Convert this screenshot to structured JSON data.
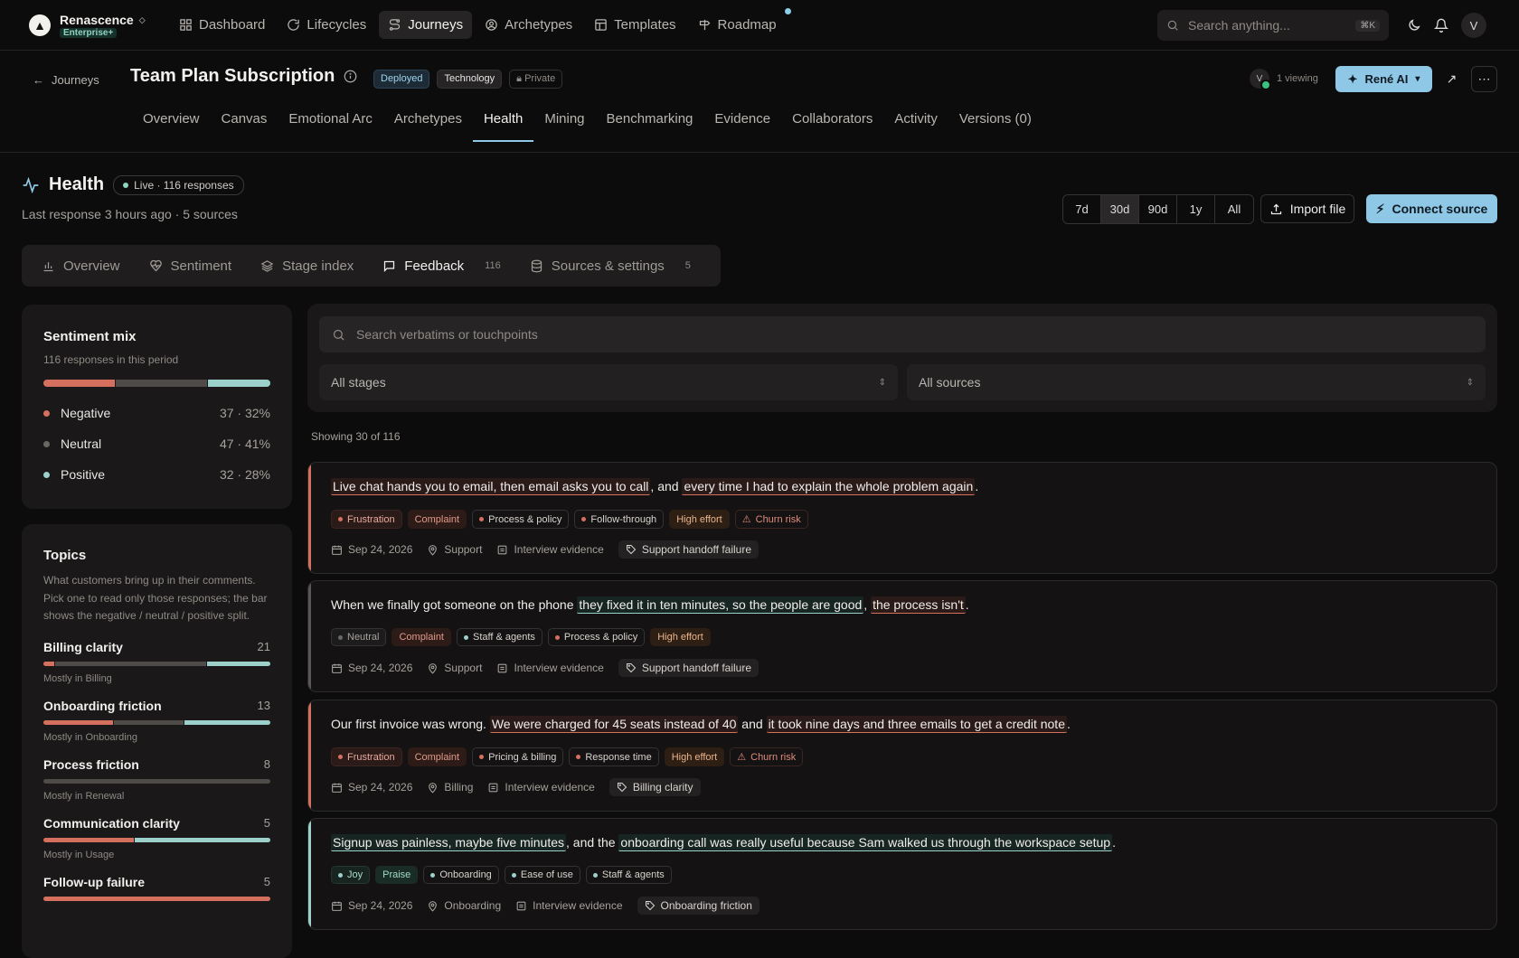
{
  "brand": {
    "name": "Renascence",
    "plan": "Enterprise+"
  },
  "nav": [
    {
      "label": "Dashboard",
      "icon": "grid-icon"
    },
    {
      "label": "Lifecycles",
      "icon": "cycle-icon"
    },
    {
      "label": "Journeys",
      "icon": "route-icon",
      "active": true
    },
    {
      "label": "Archetypes",
      "icon": "user-circle-icon"
    },
    {
      "label": "Templates",
      "icon": "template-icon"
    },
    {
      "label": "Roadmap",
      "icon": "signpost-icon"
    }
  ],
  "search": {
    "placeholder": "Search anything...",
    "shortcut": "⌘K"
  },
  "user_initial": "V",
  "page": {
    "back_label": "Journeys",
    "title": "Team Plan Subscription",
    "badges": [
      "Deployed",
      "Technology",
      "Private"
    ],
    "viewing": "1 viewing",
    "viewer_initial": "V",
    "ai_button": "René AI",
    "tabs": [
      "Overview",
      "Canvas",
      "Emotional Arc",
      "Archetypes",
      "Health",
      "Mining",
      "Benchmarking",
      "Evidence",
      "Collaborators",
      "Activity",
      "Versions (0)"
    ],
    "active_tab": "Health"
  },
  "health": {
    "title": "Health",
    "live_badge": "Live · 116 responses",
    "subtitle": "Last response 3 hours ago · 5 sources",
    "ranges": [
      "7d",
      "30d",
      "90d",
      "1y",
      "All"
    ],
    "active_range": "30d",
    "import_label": "Import file",
    "connect_label": "Connect source"
  },
  "subtabs": [
    {
      "label": "Overview",
      "icon": "bar-chart-icon",
      "count": ""
    },
    {
      "label": "Sentiment",
      "icon": "heart-pulse-icon",
      "count": ""
    },
    {
      "label": "Stage index",
      "icon": "layers-icon",
      "count": ""
    },
    {
      "label": "Feedback",
      "icon": "message-icon",
      "count": "116",
      "active": true
    },
    {
      "label": "Sources & settings",
      "icon": "database-icon",
      "count": "5"
    }
  ],
  "sentiment_mix": {
    "title": "Sentiment mix",
    "subtitle": "116 responses in this period",
    "rows": [
      {
        "label": "Negative",
        "value": "37 · 32%",
        "pct": 32,
        "color": "#d6705e"
      },
      {
        "label": "Neutral",
        "value": "47 · 41%",
        "pct": 41,
        "color": "#4e4b48"
      },
      {
        "label": "Positive",
        "value": "32 · 28%",
        "pct": 28,
        "color": "#9cd0cb"
      }
    ]
  },
  "topics": {
    "title": "Topics",
    "description": "What customers bring up in their comments. Pick one to read only those responses; the bar shows the negative / neutral / positive split.",
    "items": [
      {
        "name": "Billing clarity",
        "count": "21",
        "mostly": "Mostly in Billing",
        "split": [
          5,
          67,
          28
        ]
      },
      {
        "name": "Onboarding friction",
        "count": "13",
        "mostly": "Mostly in Onboarding",
        "split": [
          31,
          31,
          38
        ]
      },
      {
        "name": "Process friction",
        "count": "8",
        "mostly": "Mostly in Renewal",
        "split": [
          0,
          100,
          0
        ]
      },
      {
        "name": "Communication clarity",
        "count": "5",
        "mostly": "Mostly in Usage",
        "split": [
          40,
          0,
          60
        ]
      },
      {
        "name": "Follow-up failure",
        "count": "5",
        "mostly": "",
        "split": [
          100,
          0,
          0
        ]
      }
    ]
  },
  "filters": {
    "search_placeholder": "Search verbatims or touchpoints",
    "stage_select": "All stages",
    "source_select": "All sources"
  },
  "showing": "Showing 30 of 116",
  "feedback": [
    {
      "sentiment": "neg",
      "quote": [
        {
          "t": "Live chat hands you to email, then email asks you to call",
          "h": "neg"
        },
        {
          "t": ", and ",
          "h": ""
        },
        {
          "t": "every time I had to explain the whole problem again",
          "h": "neg"
        },
        {
          "t": ".",
          "h": ""
        }
      ],
      "chips": [
        {
          "label": "Frustration",
          "kind": "emo-neg",
          "dot": "#d6705e"
        },
        {
          "label": "Complaint",
          "kind": "complaint"
        },
        {
          "label": "Process & policy",
          "kind": "plain",
          "dot": "#d6705e"
        },
        {
          "label": "Follow-through",
          "kind": "plain",
          "dot": "#d6705e"
        },
        {
          "label": "High effort",
          "kind": "effort"
        },
        {
          "label": "Churn risk",
          "kind": "churn",
          "warn": true
        }
      ],
      "date": "Sep 24, 2026",
      "stage": "Support",
      "source": "Interview evidence",
      "tag": "Support handoff failure"
    },
    {
      "sentiment": "neu",
      "quote": [
        {
          "t": "When we finally got someone on the phone ",
          "h": ""
        },
        {
          "t": "they fixed it in ten minutes, so the people are good",
          "h": "pos"
        },
        {
          "t": ", ",
          "h": ""
        },
        {
          "t": "the process isn't",
          "h": "neg"
        },
        {
          "t": ".",
          "h": ""
        }
      ],
      "chips": [
        {
          "label": "Neutral",
          "kind": "emo-neu",
          "dot": "#6b6864"
        },
        {
          "label": "Complaint",
          "kind": "complaint"
        },
        {
          "label": "Staff & agents",
          "kind": "plain",
          "dot": "#9cd0cb"
        },
        {
          "label": "Process & policy",
          "kind": "plain",
          "dot": "#d6705e"
        },
        {
          "label": "High effort",
          "kind": "effort"
        }
      ],
      "date": "Sep 24, 2026",
      "stage": "Support",
      "source": "Interview evidence",
      "tag": "Support handoff failure"
    },
    {
      "sentiment": "neg",
      "quote": [
        {
          "t": "Our first invoice was wrong. ",
          "h": ""
        },
        {
          "t": "We were charged for 45 seats instead of 40",
          "h": "neg"
        },
        {
          "t": " and ",
          "h": ""
        },
        {
          "t": "it took nine days and three emails to get a credit note",
          "h": "neg"
        },
        {
          "t": ".",
          "h": ""
        }
      ],
      "chips": [
        {
          "label": "Frustration",
          "kind": "emo-neg",
          "dot": "#d6705e"
        },
        {
          "label": "Complaint",
          "kind": "complaint"
        },
        {
          "label": "Pricing & billing",
          "kind": "plain",
          "dot": "#d6705e"
        },
        {
          "label": "Response time",
          "kind": "plain",
          "dot": "#d6705e"
        },
        {
          "label": "High effort",
          "kind": "effort"
        },
        {
          "label": "Churn risk",
          "kind": "churn",
          "warn": true
        }
      ],
      "date": "Sep 24, 2026",
      "stage": "Billing",
      "source": "Interview evidence",
      "tag": "Billing clarity"
    },
    {
      "sentiment": "pos",
      "quote": [
        {
          "t": "Signup was painless, maybe five minutes",
          "h": "pos"
        },
        {
          "t": ", and the ",
          "h": ""
        },
        {
          "t": "onboarding call was really useful because Sam walked us through the workspace setup",
          "h": "pos"
        },
        {
          "t": ".",
          "h": ""
        }
      ],
      "chips": [
        {
          "label": "Joy",
          "kind": "emo-pos",
          "dot": "#9cd0cb"
        },
        {
          "label": "Praise",
          "kind": "praise"
        },
        {
          "label": "Onboarding",
          "kind": "plain",
          "dot": "#9cd0cb"
        },
        {
          "label": "Ease of use",
          "kind": "plain",
          "dot": "#9cd0cb"
        },
        {
          "label": "Staff & agents",
          "kind": "plain",
          "dot": "#9cd0cb"
        }
      ],
      "date": "Sep 24, 2026",
      "stage": "Onboarding",
      "source": "Interview evidence",
      "tag": "Onboarding friction"
    }
  ]
}
